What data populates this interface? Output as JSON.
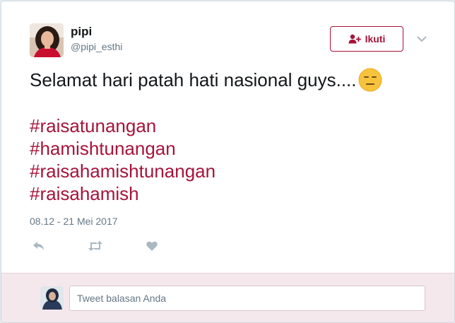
{
  "tweet": {
    "author": {
      "display_name": "pipi",
      "username": "@pipi_esthi"
    },
    "follow_label": "Ikuti",
    "text": "Selamat hari patah hati nasional guys....",
    "hashtags": [
      "#raisatunangan",
      "#hamishtunangan",
      "#raisahamishtunangan",
      "#raisahamish"
    ],
    "timestamp": "08.12 - 21 Mei 2017"
  },
  "reply": {
    "placeholder": "Tweet balasan Anda"
  },
  "icons": {
    "follow": "add-user-icon",
    "menu": "chevron-down-icon",
    "emoji": "expressionless-face-emoji",
    "reply": "reply-icon",
    "retweet": "retweet-icon",
    "like": "heart-icon"
  },
  "colors": {
    "accent": "#a5143a",
    "text": "#14171a",
    "muted": "#657786",
    "reply_bg": "#f5e8ec"
  }
}
